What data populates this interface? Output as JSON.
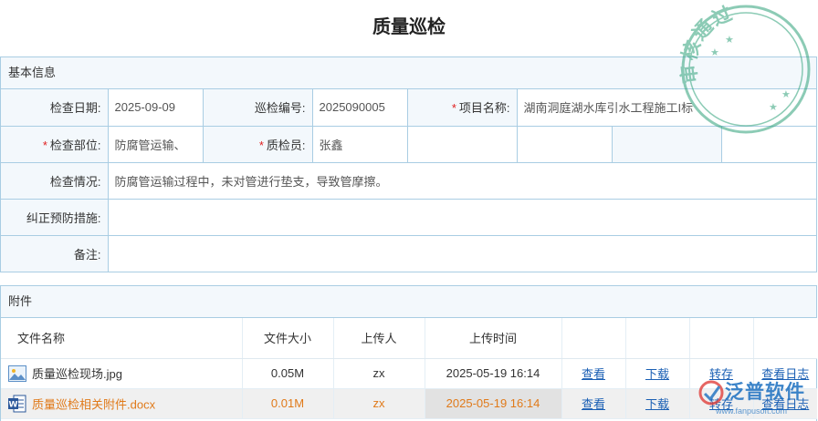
{
  "page": {
    "title": "质量巡检"
  },
  "stamp": {
    "text": "审核通过"
  },
  "basic": {
    "header": "基本信息",
    "inspect_date_label": "检查日期:",
    "inspect_date": "2025-09-09",
    "patrol_no_label": "巡检编号:",
    "patrol_no": "2025090005",
    "project_label": "项目名称:",
    "project": "湖南洞庭湖水库引水工程施工I标",
    "part_label": "检查部位:",
    "part": "防腐管运输、",
    "inspector_label": "质检员:",
    "inspector": "张鑫",
    "situation_label": "检查情况:",
    "situation": "防腐管运输过程中，未对管进行垫支，导致管摩擦。",
    "measures_label": "纠正预防措施:",
    "measures": "",
    "remark_label": "备注:",
    "remark": "",
    "required_mark": "*"
  },
  "attachments": {
    "header": "附件",
    "columns": {
      "name": "文件名称",
      "size": "文件大小",
      "uploader": "上传人",
      "time": "上传时间"
    },
    "actions": {
      "view": "查看",
      "download": "下载",
      "transfer": "转存",
      "log": "查看日志"
    },
    "rows": [
      {
        "name": "质量巡检现场.jpg",
        "size": "0.05M",
        "uploader": "zx",
        "time": "2025-05-19 16:14",
        "icon": "image-file-icon"
      },
      {
        "name": "质量巡检相关附件.docx",
        "size": "0.01M",
        "uploader": "zx",
        "time": "2025-05-19 16:14",
        "icon": "word-file-icon"
      }
    ]
  },
  "watermark": {
    "text": "泛普软件",
    "sub": "www.fanpusoft.com"
  },
  "colors": {
    "border": "#a9cde3",
    "label_bg": "#f3f8fc",
    "link": "#1a5fb4",
    "required": "#e02020",
    "highlight_text": "#e07a1a",
    "stamp": "#2fa27a"
  }
}
